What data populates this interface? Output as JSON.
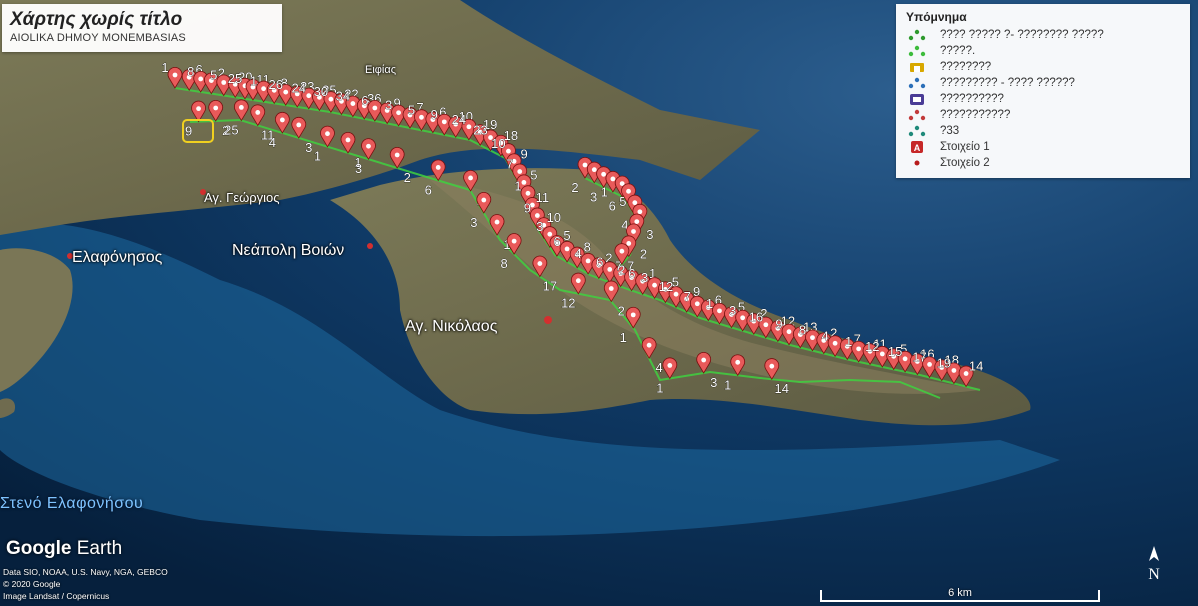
{
  "title_card": {
    "title": "Χάρτης χωρίς τίτλο",
    "subtitle": "AIOLIKA DHMOY MONEMBASIAS"
  },
  "legend": {
    "title": "Υπόμνημα",
    "items": [
      {
        "label": "???? ????? ?- ???????? ?????",
        "icon": "green-path-icon",
        "color": "#2e9a2e"
      },
      {
        "label": "?????.",
        "icon": "green-path-icon",
        "color": "#3cbc3c"
      },
      {
        "label": "????????",
        "icon": "tower-icon",
        "color": "#d8a800"
      },
      {
        "label": "????????? - ???? ??????",
        "icon": "blue-path-icon",
        "color": "#2b6fb8"
      },
      {
        "label": "??????????",
        "icon": "building-icon",
        "color": "#4a3c96"
      },
      {
        "label": "???????????",
        "icon": "red-path-icon",
        "color": "#c23a3a"
      },
      {
        "label": "?33",
        "icon": "teal-path-icon",
        "color": "#1f8a7a"
      },
      {
        "label": "Στοιχείο 1",
        "icon": "red-marker-icon",
        "color": "#c62828"
      },
      {
        "label": "Στοιχείο 2",
        "icon": "red-dot-icon",
        "color": "#b71c1c"
      }
    ]
  },
  "places": {
    "ag_georgios": "Αγ. Γεώργιος",
    "elafonisos": "Ελαφόνησος",
    "neapoli": "Νεάπολη Βοιών",
    "ag_nikolaos": "Αγ. Νικόλαος",
    "stenο": "Στενό Ελαφονήσου",
    "eyfias": "Ειφίας"
  },
  "branding": {
    "google": "Google",
    "earth": "Earth"
  },
  "credits": [
    "Data SIO, NOAA, U.S. Navy, NGA, GEBCO",
    "© 2020 Google",
    "Image Landsat / Copernicus"
  ],
  "scale": {
    "label": "6 km"
  },
  "compass": {
    "letter": "N"
  },
  "colors": {
    "sea": "#0f3a66",
    "land": "#6b6a52",
    "marker": "#e85a5a",
    "track": "#3fd03f"
  },
  "markers": {
    "upper": [
      {
        "n": "1",
        "p": 0.0
      },
      {
        "n": "6",
        "p": 0.016
      },
      {
        "n": "8",
        "p": 0.029
      },
      {
        "n": "2",
        "p": 0.041
      },
      {
        "n": "5",
        "p": 0.055
      },
      {
        "n": "20",
        "p": 0.068
      },
      {
        "n": "25",
        "p": 0.079
      },
      {
        "n": "11",
        "p": 0.088
      },
      {
        "n": "1",
        "p": 0.1
      },
      {
        "n": "8",
        "p": 0.112
      },
      {
        "n": "26",
        "p": 0.125
      },
      {
        "n": "23",
        "p": 0.138
      },
      {
        "n": "24",
        "p": 0.151
      },
      {
        "n": "25",
        "p": 0.163
      },
      {
        "n": "30",
        "p": 0.176
      },
      {
        "n": "22",
        "p": 0.188
      },
      {
        "n": "34",
        "p": 0.201
      },
      {
        "n": "36",
        "p": 0.214
      },
      {
        "n": "6",
        "p": 0.226
      },
      {
        "n": "9",
        "p": 0.24
      },
      {
        "n": "3",
        "p": 0.253
      },
      {
        "n": "7",
        "p": 0.266
      },
      {
        "n": "5",
        "p": 0.279
      },
      {
        "n": "6",
        "p": 0.292
      },
      {
        "n": "9",
        "p": 0.305
      },
      {
        "n": "10",
        "p": 0.318
      },
      {
        "n": "24",
        "p": 0.333
      },
      {
        "n": "19",
        "p": 0.347
      },
      {
        "n": "23",
        "p": 0.36
      },
      {
        "n": "18",
        "p": 0.373
      },
      {
        "n": "10",
        "p": 0.386
      },
      {
        "n": "9",
        "p": 0.399
      },
      {
        "n": "7",
        "p": 0.412
      },
      {
        "n": "5",
        "p": 0.425
      },
      {
        "n": "1",
        "p": 0.438
      },
      {
        "n": "11",
        "p": 0.452
      },
      {
        "n": "9",
        "p": 0.465
      },
      {
        "n": "10",
        "p": 0.478
      },
      {
        "n": "3",
        "p": 0.49
      },
      {
        "n": "5",
        "p": 0.503
      },
      {
        "n": "6",
        "p": 0.516
      },
      {
        "n": "8",
        "p": 0.529
      },
      {
        "n": "4",
        "p": 0.543
      },
      {
        "n": "2",
        "p": 0.556
      },
      {
        "n": "6",
        "p": 0.569
      },
      {
        "n": "7",
        "p": 0.582
      },
      {
        "n": "2",
        "p": 0.595
      },
      {
        "n": "1",
        "p": 0.608
      },
      {
        "n": "3",
        "p": 0.622
      },
      {
        "n": "5",
        "p": 0.635
      },
      {
        "n": "12",
        "p": 0.648
      },
      {
        "n": "9",
        "p": 0.661
      },
      {
        "n": "7",
        "p": 0.674
      },
      {
        "n": "6",
        "p": 0.687
      },
      {
        "n": "1",
        "p": 0.7
      },
      {
        "n": "5",
        "p": 0.714
      },
      {
        "n": "3",
        "p": 0.727
      },
      {
        "n": "2",
        "p": 0.74
      },
      {
        "n": "16",
        "p": 0.754
      },
      {
        "n": "12",
        "p": 0.768
      },
      {
        "n": "9",
        "p": 0.781
      },
      {
        "n": "13",
        "p": 0.794
      },
      {
        "n": "8",
        "p": 0.808
      },
      {
        "n": "2",
        "p": 0.821
      },
      {
        "n": "4",
        "p": 0.834
      },
      {
        "n": "7",
        "p": 0.848
      },
      {
        "n": "1",
        "p": 0.861
      },
      {
        "n": "11",
        "p": 0.874
      },
      {
        "n": "12",
        "p": 0.888
      },
      {
        "n": "5",
        "p": 0.901
      },
      {
        "n": "15",
        "p": 0.914
      },
      {
        "n": "16",
        "p": 0.928
      },
      {
        "n": "17",
        "p": 0.942
      },
      {
        "n": "18",
        "p": 0.956
      },
      {
        "n": "19",
        "p": 0.97
      },
      {
        "n": "14",
        "p": 0.984
      }
    ],
    "lower": [
      {
        "n": "9",
        "p": 0.01
      },
      {
        "n": "2",
        "p": 0.03
      },
      {
        "n": "25",
        "p": 0.06
      },
      {
        "n": "11",
        "p": 0.08
      },
      {
        "n": "4",
        "p": 0.11
      },
      {
        "n": "3",
        "p": 0.13
      },
      {
        "n": "1",
        "p": 0.165
      },
      {
        "n": "1",
        "p": 0.19
      },
      {
        "n": "3",
        "p": 0.215
      },
      {
        "n": "2",
        "p": 0.25
      },
      {
        "n": "6",
        "p": 0.3
      },
      {
        "n": "2",
        "p": 0.34
      },
      {
        "n": "3",
        "p": 0.37
      },
      {
        "n": "1",
        "p": 0.4
      },
      {
        "n": "8",
        "p": 0.43
      },
      {
        "n": "17",
        "p": 0.47
      },
      {
        "n": "12",
        "p": 0.52
      },
      {
        "n": "2",
        "p": 0.56
      },
      {
        "n": "1",
        "p": 0.6
      },
      {
        "n": "4",
        "p": 0.64
      },
      {
        "n": "1",
        "p": 0.68
      },
      {
        "n": "3",
        "p": 0.72
      },
      {
        "n": "1",
        "p": 0.76
      },
      {
        "n": "14",
        "p": 0.8
      }
    ],
    "side": [
      {
        "n": "2",
        "p": 0.0
      },
      {
        "n": "1",
        "p": 0.08
      },
      {
        "n": "3",
        "p": 0.16
      },
      {
        "n": "5",
        "p": 0.24
      },
      {
        "n": "6",
        "p": 0.32
      },
      {
        "n": "8",
        "p": 0.4
      },
      {
        "n": "4",
        "p": 0.5
      },
      {
        "n": "3",
        "p": 0.58
      },
      {
        "n": "5",
        "p": 0.66
      },
      {
        "n": "2",
        "p": 0.74
      },
      {
        "n": "7",
        "p": 0.84
      },
      {
        "n": "6",
        "p": 0.92
      }
    ]
  }
}
